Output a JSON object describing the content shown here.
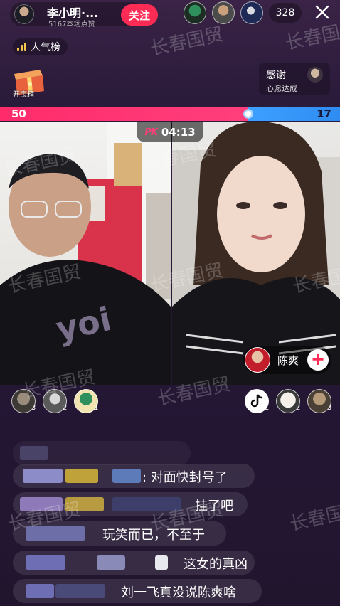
{
  "header": {
    "host_name": "李小明·...",
    "host_likes": "5167本场点赞",
    "follow_label": "关注",
    "viewer_count": "328"
  },
  "rank": {
    "label": "人气榜"
  },
  "treasure": {
    "label": "开宝箱"
  },
  "thanks": {
    "title": "感谢",
    "subtitle": "心愿达成"
  },
  "pk": {
    "left_score": "50",
    "right_score": "17",
    "left_share": 0.73,
    "timer": "04:13",
    "logo": "PK",
    "colors": {
      "left": "#ff2b6a",
      "right": "#3da0ff"
    }
  },
  "opponent": {
    "name": "陈爽",
    "plus_label": "+"
  },
  "contributors_left": [
    {
      "rank": "3"
    },
    {
      "rank": "2"
    },
    {
      "rank": "1"
    }
  ],
  "contributors_right": [
    {
      "rank": "1"
    },
    {
      "rank": "2"
    },
    {
      "rank": "3"
    }
  ],
  "watermark": "长春国贸",
  "chat": [
    {
      "text": ": 对面快封号了"
    },
    {
      "text": "挂了吧"
    },
    {
      "text": "玩笑而已，不至于"
    },
    {
      "text": "这女的真凶"
    },
    {
      "text": "刘一飞真没说陈爽啥"
    }
  ]
}
